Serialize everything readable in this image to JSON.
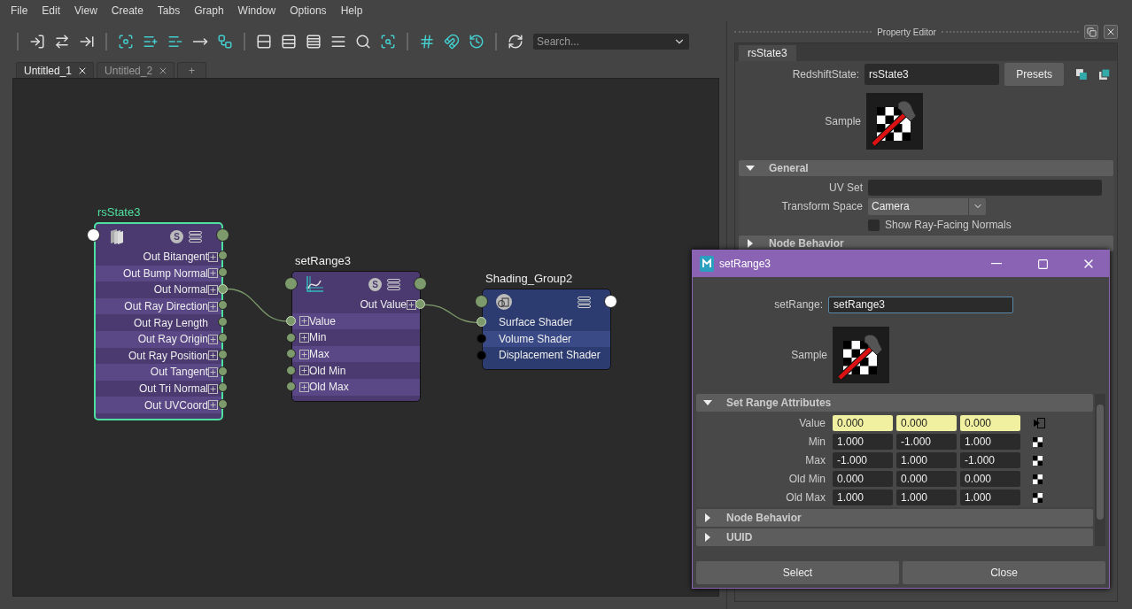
{
  "menu": [
    "File",
    "Edit",
    "View",
    "Create",
    "Tabs",
    "Graph",
    "Window",
    "Options",
    "Help"
  ],
  "toolbar": {
    "search": {
      "placeholder": "Search..."
    }
  },
  "graph_tabs": [
    {
      "label": "Untitled_1",
      "selected": true
    },
    {
      "label": "Untitled_2",
      "selected": false
    }
  ],
  "new_tab": "+",
  "nodes": [
    {
      "title": "rsState3",
      "kind": "redshift",
      "selected": true,
      "badge": "S",
      "header_ports": [
        {
          "kind": "input",
          "color": "#ffffff"
        },
        {
          "kind": "output",
          "color": "#7c9a6b"
        }
      ],
      "attributes": [
        {
          "label": "Out Bitangent",
          "kind": "output",
          "expandable": true,
          "connected": false,
          "color": "#7c9a6b"
        },
        {
          "label": "Out Bump Normal",
          "kind": "output",
          "expandable": true,
          "connected": false,
          "color": "#7c9a6b"
        },
        {
          "label": "Out Normal",
          "kind": "output",
          "expandable": true,
          "connected": true,
          "color": "#7c9a6b"
        },
        {
          "label": "Out Ray Direction",
          "kind": "output",
          "expandable": true,
          "connected": false,
          "color": "#7c9a6b"
        },
        {
          "label": "Out Ray Length",
          "kind": "output",
          "expandable": false,
          "connected": false,
          "color": "#7c9a6b"
        },
        {
          "label": "Out Ray Origin",
          "kind": "output",
          "expandable": true,
          "connected": false,
          "color": "#7c9a6b"
        },
        {
          "label": "Out Ray Position",
          "kind": "output",
          "expandable": true,
          "connected": false,
          "color": "#7c9a6b"
        },
        {
          "label": "Out Tangent",
          "kind": "output",
          "expandable": true,
          "connected": false,
          "color": "#7c9a6b"
        },
        {
          "label": "Out Tri Normal",
          "kind": "output",
          "expandable": true,
          "connected": false,
          "color": "#7c9a6b"
        },
        {
          "label": "Out UVCoord",
          "kind": "output",
          "expandable": true,
          "connected": false,
          "color": "#7c9a6b"
        }
      ]
    },
    {
      "title": "setRange3",
      "kind": "utility",
      "selected": false,
      "badge": "S",
      "header_ports": [
        {
          "kind": "input",
          "color": "#7c9a6b"
        },
        {
          "kind": "output",
          "color": "#7c9a6b"
        }
      ],
      "attributes": [
        {
          "label": "Out Value",
          "kind": "output",
          "expandable": true,
          "connected": true,
          "color": "#7c9a6b"
        },
        {
          "label": "Value",
          "kind": "input",
          "expandable": true,
          "connected": true,
          "color": "#7c9a6b"
        },
        {
          "label": "Min",
          "kind": "input",
          "expandable": true,
          "connected": false,
          "color": "#7c9a6b"
        },
        {
          "label": "Max",
          "kind": "input",
          "expandable": true,
          "connected": false,
          "color": "#7c9a6b"
        },
        {
          "label": "Old Min",
          "kind": "input",
          "expandable": true,
          "connected": false,
          "color": "#7c9a6b"
        },
        {
          "label": "Old Max",
          "kind": "input",
          "expandable": true,
          "connected": false,
          "color": "#7c9a6b"
        }
      ]
    },
    {
      "title": "Shading_Group2",
      "kind": "shading_group",
      "selected": false,
      "header_ports": [
        {
          "kind": "input",
          "color": "#7c9a6b"
        },
        {
          "kind": "output",
          "color": "#ffffff"
        }
      ],
      "attributes": [
        {
          "label": "Surface Shader",
          "kind": "input",
          "expandable": false,
          "connected": true,
          "color": "#7c9a6b"
        },
        {
          "label": "Volume Shader",
          "kind": "input",
          "expandable": false,
          "connected": false,
          "color": "#000000"
        },
        {
          "label": "Displacement Shader",
          "kind": "input",
          "expandable": false,
          "connected": false,
          "color": "#000000"
        }
      ]
    }
  ],
  "property_editor": {
    "title": "Property Editor",
    "tabs": [
      {
        "label": "rsState3",
        "selected": true
      }
    ],
    "name_label": "RedshiftState:",
    "name_value": "rsState3",
    "presets": "Presets",
    "sample_label": "Sample",
    "sections": [
      {
        "title": "General",
        "expanded": true,
        "fields": [
          {
            "kind": "text",
            "label": "UV Set"
          },
          {
            "kind": "dropdown",
            "label": "Transform Space",
            "value": "Camera"
          },
          {
            "kind": "checkbox",
            "label": "Show Ray-Facing Normals",
            "checked": false
          }
        ]
      },
      {
        "title": "Node Behavior",
        "expanded": false
      }
    ]
  },
  "dialog": {
    "title": "setRange3",
    "name_label": "setRange:",
    "name_value": "setRange3",
    "sample_label": "Sample",
    "sections": [
      {
        "title": "Set Range Attributes",
        "expanded": true,
        "rows": [
          {
            "label": "Value",
            "connected": true,
            "values": [
              "0.000",
              "0.000",
              "0.000"
            ]
          },
          {
            "label": "Min",
            "connected": false,
            "values": [
              "1.000",
              "-1.000",
              "1.000"
            ]
          },
          {
            "label": "Max",
            "connected": false,
            "values": [
              "-1.000",
              "1.000",
              "-1.000"
            ]
          },
          {
            "label": "Old Min",
            "connected": false,
            "values": [
              "0.000",
              "0.000",
              "0.000"
            ]
          },
          {
            "label": "Old Max",
            "connected": false,
            "values": [
              "1.000",
              "1.000",
              "1.000"
            ]
          }
        ]
      },
      {
        "title": "Node Behavior",
        "expanded": false
      },
      {
        "title": "UUID",
        "expanded": false
      }
    ],
    "buttons": [
      "Select",
      "Close"
    ]
  }
}
